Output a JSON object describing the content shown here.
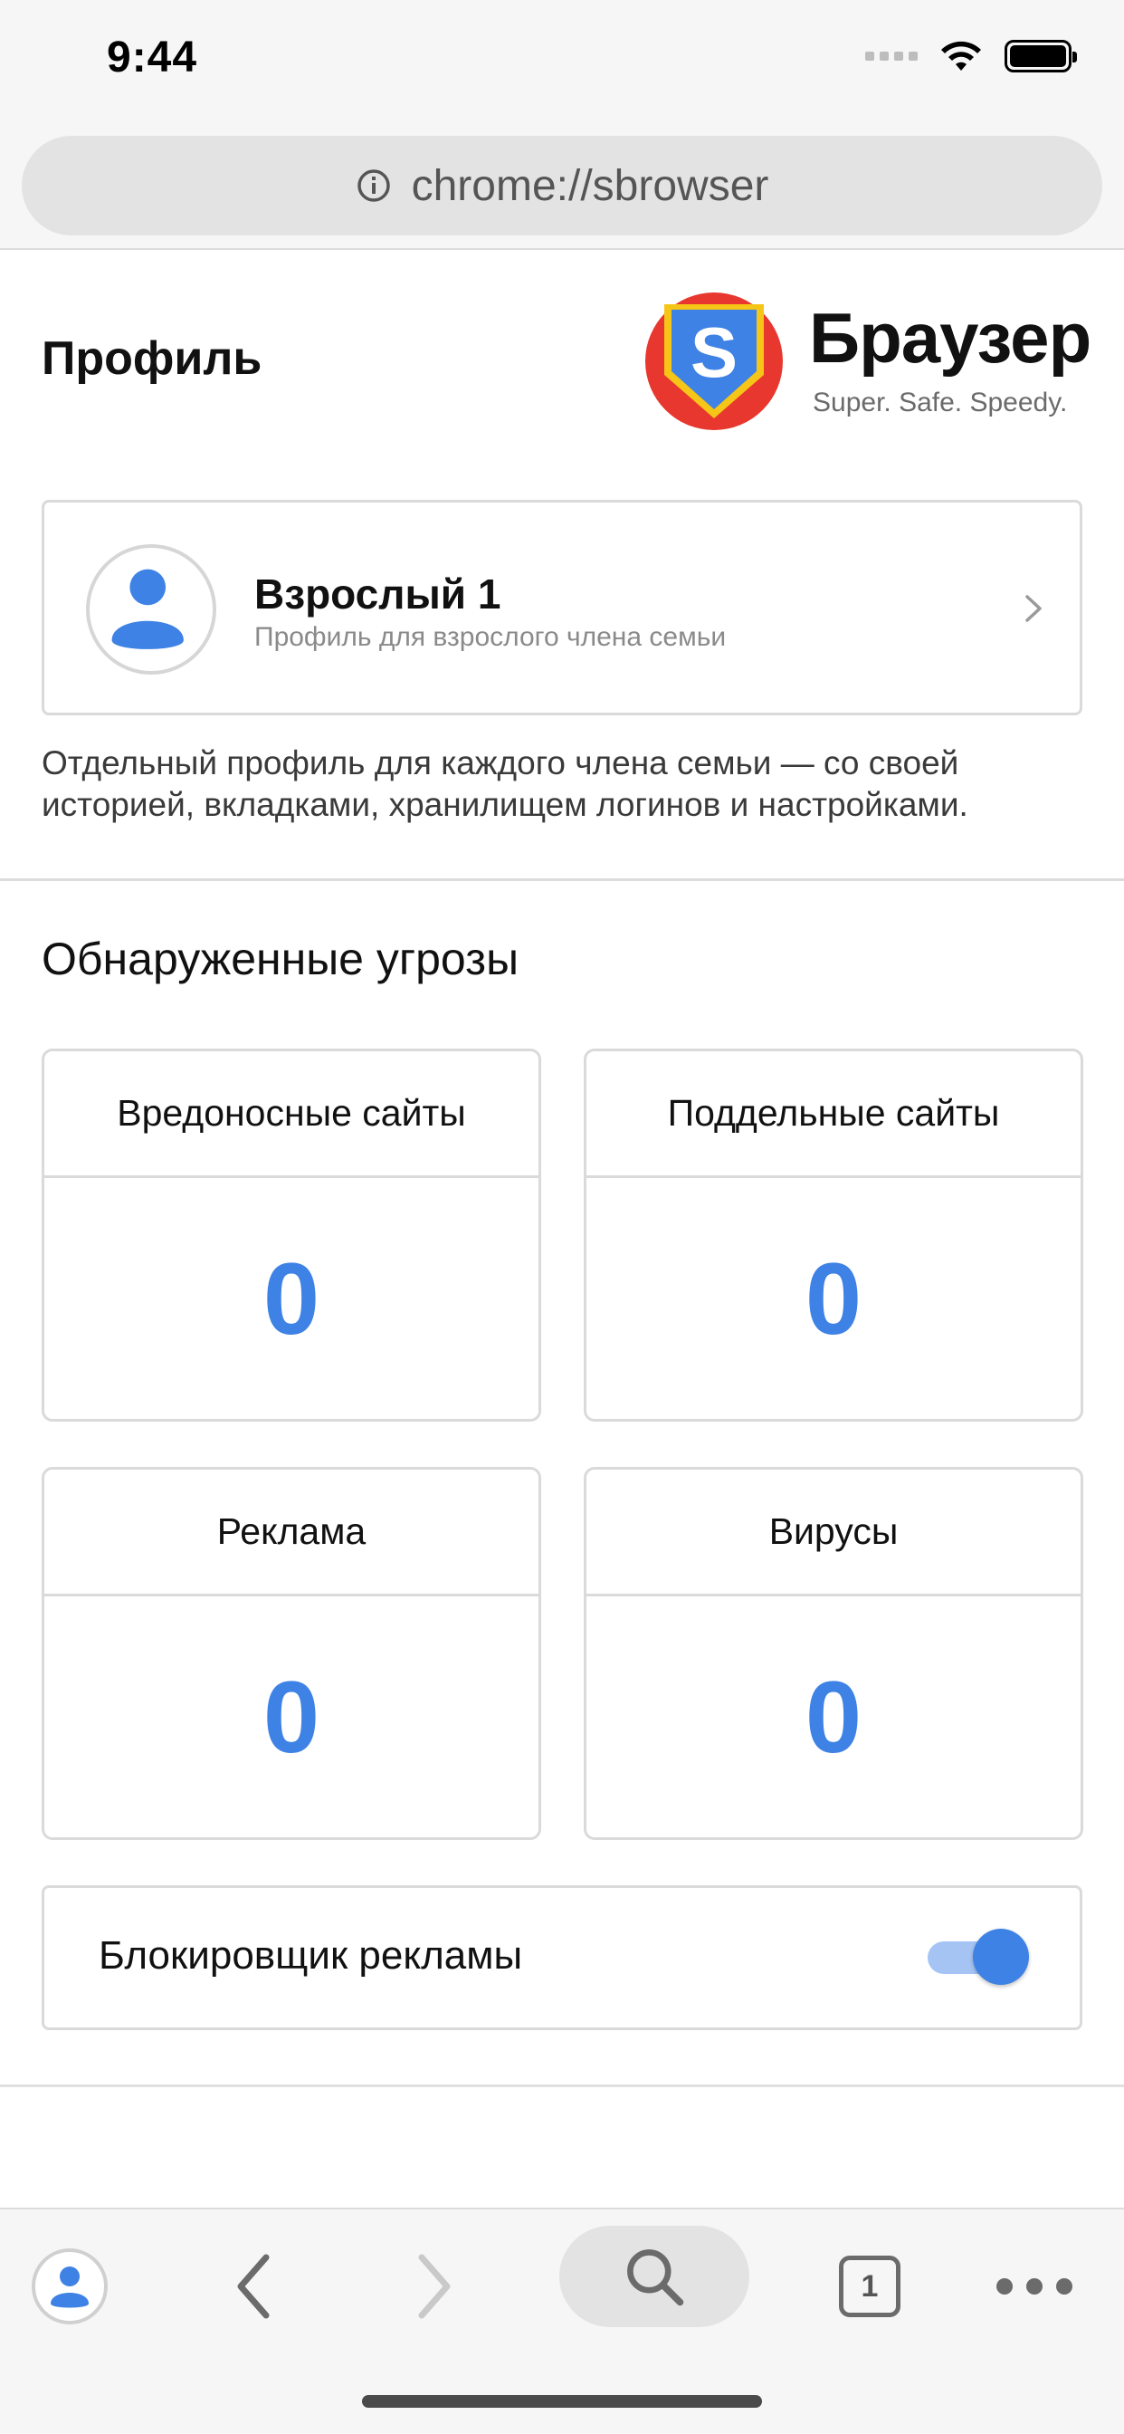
{
  "status_bar": {
    "time": "9:44"
  },
  "address_bar": {
    "url": "chrome://sbrowser"
  },
  "profile_section": {
    "title": "Профиль",
    "brand": {
      "name": "Браузер",
      "tagline": "Super. Safe. Speedy.",
      "logo_letter": "S"
    },
    "card": {
      "name": "Взрослый 1",
      "subtitle": "Профиль для взрослого члена семьи"
    },
    "description": "Отдельный профиль для каждого члена семьи — со своей историей, вкладками, хранилищем логинов и настройками."
  },
  "threats_section": {
    "title": "Обнаруженные угрозы",
    "tiles": [
      {
        "label": "Вредоносные сайты",
        "value": "0"
      },
      {
        "label": "Поддельные сайты",
        "value": "0"
      },
      {
        "label": "Реклама",
        "value": "0"
      },
      {
        "label": "Вирусы",
        "value": "0"
      }
    ]
  },
  "ad_blocker": {
    "label": "Блокировщик рекламы",
    "enabled": true
  },
  "bottom_bar": {
    "tab_count": "1"
  },
  "colors": {
    "accent": "#3e82e5",
    "border": "#dadada",
    "chrome_bg": "#f6f6f6"
  }
}
